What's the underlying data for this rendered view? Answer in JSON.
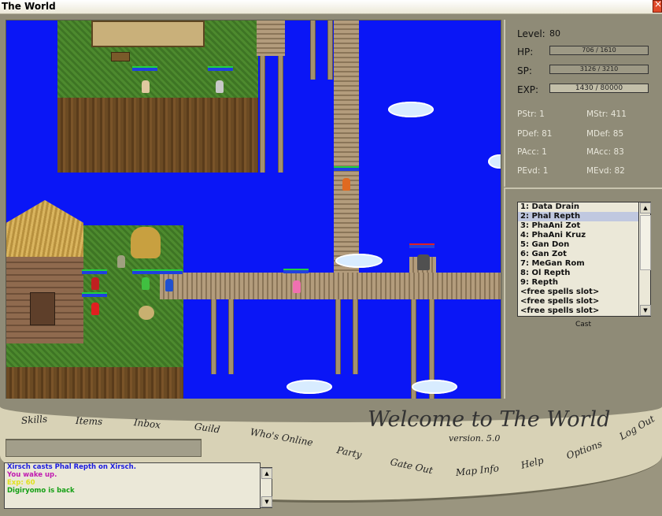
{
  "window": {
    "title": "The World"
  },
  "stats": {
    "level_label": "Level:",
    "level": "80",
    "hp_label": "HP:",
    "hp_text": "706 / 1610",
    "sp_label": "SP:",
    "sp_text": "3126 / 3210",
    "exp_label": "EXP:",
    "exp_text": "1430 / 80000",
    "pstr": "PStr: 1",
    "mstr": "MStr: 411",
    "pdef": "PDef: 81",
    "mdef": "MDef: 85",
    "pacc": "PAcc: 1",
    "macc": "MAcc: 83",
    "pevd": "PEvd: 1",
    "mevd": "MEvd: 82"
  },
  "spells": {
    "items": [
      "1: Data Drain",
      "2: Phal Repth",
      "3: PhaAni Zot",
      "4: PhaAni Kruz",
      "5: Gan Don",
      "6: Gan Zot",
      "7: MeGan Rom",
      "8: Ol Repth",
      "9: Repth",
      "<free spells slot>",
      "<free spells slot>",
      "<free spells slot>"
    ],
    "selected_index": 1,
    "cast_label": "Cast"
  },
  "menu": {
    "skills": "Skills",
    "items": "Items",
    "inbox": "Inbox",
    "guild": "Guild",
    "whos_online": "Who's Online",
    "party": "Party",
    "gate_out": "Gate Out",
    "map_info": "Map Info",
    "help": "Help",
    "options": "Options",
    "log_out": "Log Out"
  },
  "banner": {
    "welcome": "Welcome to The World",
    "version": "version. 5.0"
  },
  "chat": {
    "lines": [
      {
        "text": "Xirsch casts Phal Repth on Xirsch.",
        "color": "#1a1ae0"
      },
      {
        "text": "You wake up.",
        "color": "#c01ab0"
      },
      {
        "text": "Exp: 60",
        "color": "#e0e020"
      },
      {
        "text": "Digiryomo is back",
        "color": "#16a016"
      }
    ]
  },
  "colors": {
    "water": "#0a16f6",
    "panel": "#8f8b77",
    "banner": "#d8d2b6"
  }
}
